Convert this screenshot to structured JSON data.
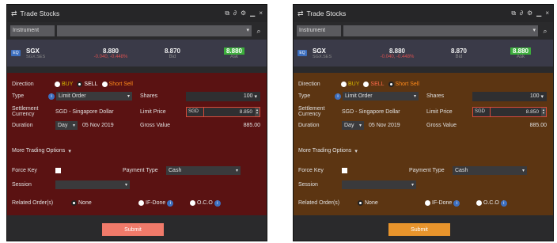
{
  "window": {
    "title": "Trade Stocks",
    "instrument_label": "Instrument",
    "quote": {
      "logo": "EQ",
      "symbol": "SGX",
      "sub": "SGX.SES",
      "last": "8.880",
      "change": "-0.040, -0.448%",
      "bid": "8.870",
      "bid_label": "Bid",
      "ask": "8.880",
      "ask_label": "Ask"
    },
    "direction_label": "Direction",
    "buy": "BUY",
    "sell": "SELL",
    "short_sell": "Short Sell",
    "type_label": "Type",
    "type_value": "Limit Order",
    "shares_label": "Shares",
    "shares_value": "100",
    "settlement_label": "Settlement Currency",
    "settlement_value": "SGD - Singapore Dollar",
    "limit_price_label": "Limit Price",
    "limit_currency": "SGD",
    "limit_price": "8.850",
    "duration_label": "Duration",
    "duration_value": "Day",
    "duration_date": "05 Nov 2019",
    "gross_label": "Gross Value",
    "gross_value": "885.00",
    "more_options": "More Trading Options",
    "force_key_label": "Force Key",
    "payment_label": "Payment Type",
    "payment_value": "Cash",
    "session_label": "Session",
    "related_label": "Related Order(s)",
    "none": "None",
    "if_done": "IF-Done",
    "oco": "O.C.O",
    "submit": "Submit"
  },
  "colors": {
    "red_form": "#5a1212",
    "orange_form": "#5c3512",
    "red_submit": "#f07a6a",
    "orange_submit": "#e8942c"
  }
}
